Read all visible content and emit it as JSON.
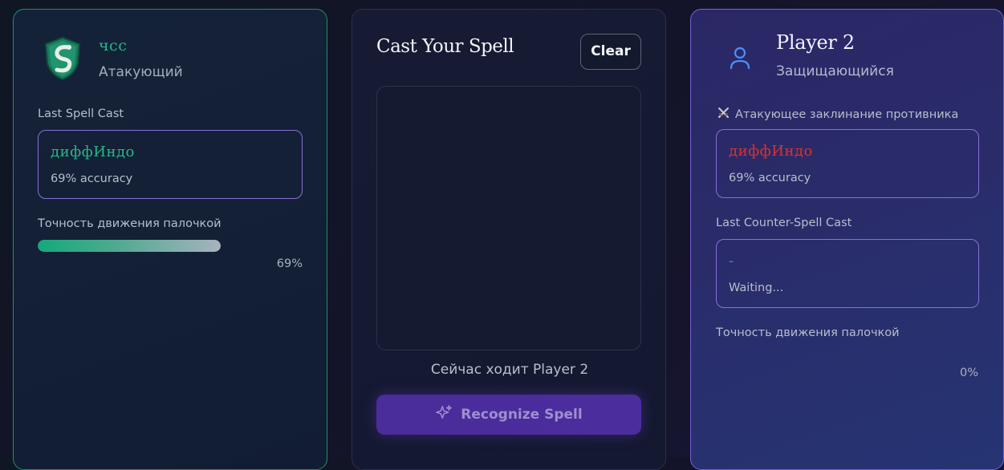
{
  "player1": {
    "name": "чсс",
    "role": "Атакующий",
    "last_spell_label": "Last Spell Cast",
    "last_spell": {
      "name": "диффИндо",
      "accuracy": "69% accuracy",
      "color": "#23b98a"
    },
    "wand_label": "Точность движения палочкой",
    "wand_accuracy_text": "69%",
    "wand_accuracy": 0.69
  },
  "center": {
    "title": "Cast Your Spell",
    "clear_label": "Clear",
    "turn_text": "Сейчас ходит Player 2",
    "recognize_label": "Recognize Spell"
  },
  "player2": {
    "name": "Player 2",
    "role": "Защищающийся",
    "opponent_spell_label": "Атакующее заклинание противника",
    "opponent_spell": {
      "name": "диффИндо",
      "accuracy": "69% accuracy",
      "color": "#e0302b"
    },
    "counter_label": "Last Counter-Spell Cast",
    "counter_spell": {
      "name": "-",
      "status": "Waiting...",
      "color": "#3d7cf0"
    },
    "wand_label": "Точность движения палочкой",
    "wand_accuracy_text": "0%",
    "wand_accuracy": 0
  },
  "icons": {
    "crest": "serpent-crest-icon",
    "avatar": "user-icon",
    "swords": "crossed-swords-icon",
    "sparkles": "sparkles-icon"
  }
}
